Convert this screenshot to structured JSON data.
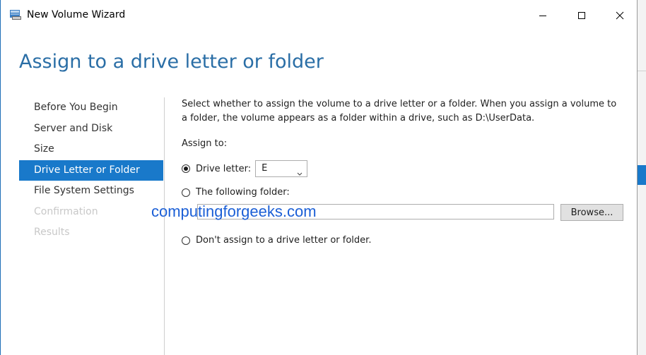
{
  "window": {
    "title": "New Volume Wizard"
  },
  "page": {
    "heading": "Assign to a drive letter or folder"
  },
  "nav": {
    "items": [
      {
        "label": "Before You Begin",
        "state": "normal"
      },
      {
        "label": "Server and Disk",
        "state": "normal"
      },
      {
        "label": "Size",
        "state": "normal"
      },
      {
        "label": "Drive Letter or Folder",
        "state": "active"
      },
      {
        "label": "File System Settings",
        "state": "normal"
      },
      {
        "label": "Confirmation",
        "state": "disabled"
      },
      {
        "label": "Results",
        "state": "disabled"
      }
    ]
  },
  "content": {
    "description": "Select whether to assign the volume to a drive letter or a folder. When you assign a volume to a folder, the volume appears as a folder within a drive, such as D:\\UserData.",
    "assign_to_label": "Assign to:",
    "options": {
      "drive_letter": {
        "label": "Drive letter:",
        "selected": true,
        "value": "E"
      },
      "folder": {
        "label": "The following folder:",
        "selected": false,
        "path": ""
      },
      "none": {
        "label": "Don't assign to a drive letter or folder.",
        "selected": false
      }
    },
    "browse_label": "Browse..."
  },
  "watermark": "computingforgeeks.com",
  "colors": {
    "accent": "#1979ca",
    "heading": "#2a6ea6",
    "watermark": "#1b5fd6"
  },
  "icons": {
    "app": "volume-wizard-icon",
    "minimize": "minimize-icon",
    "maximize": "maximize-icon",
    "close": "close-icon"
  }
}
